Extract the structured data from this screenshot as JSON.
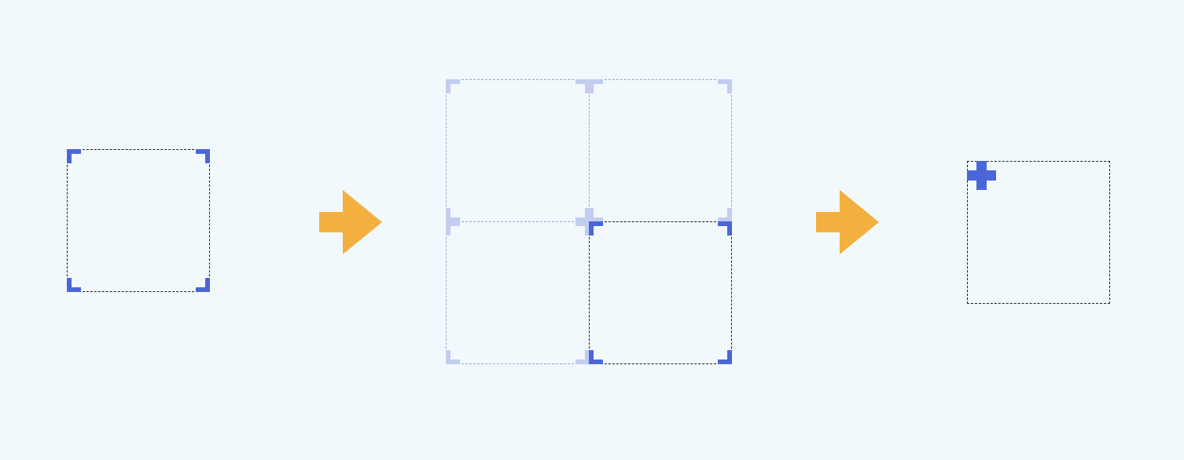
{
  "colors": {
    "background": "#f2f9fd",
    "marker": "#4a66d8",
    "marker_faded": "#c2cdf0",
    "arrow": "#f3b03e",
    "border_active": "#1b1b1b",
    "border_faded": "#9aa3bf"
  },
  "steps": [
    {
      "name": "single-tile",
      "corners": [
        "top-left",
        "top-right",
        "bottom-left",
        "bottom-right"
      ]
    },
    {
      "name": "quad-split",
      "tiles": [
        "top-left",
        "top-right",
        "bottom-left",
        "bottom-right"
      ],
      "active_tile": "bottom-right"
    },
    {
      "name": "origin-point",
      "marker": "cross-icon",
      "marker_position": "top-left"
    }
  ],
  "icons": [
    "corner-marker-icon",
    "right-arrow-icon",
    "cross-icon"
  ]
}
